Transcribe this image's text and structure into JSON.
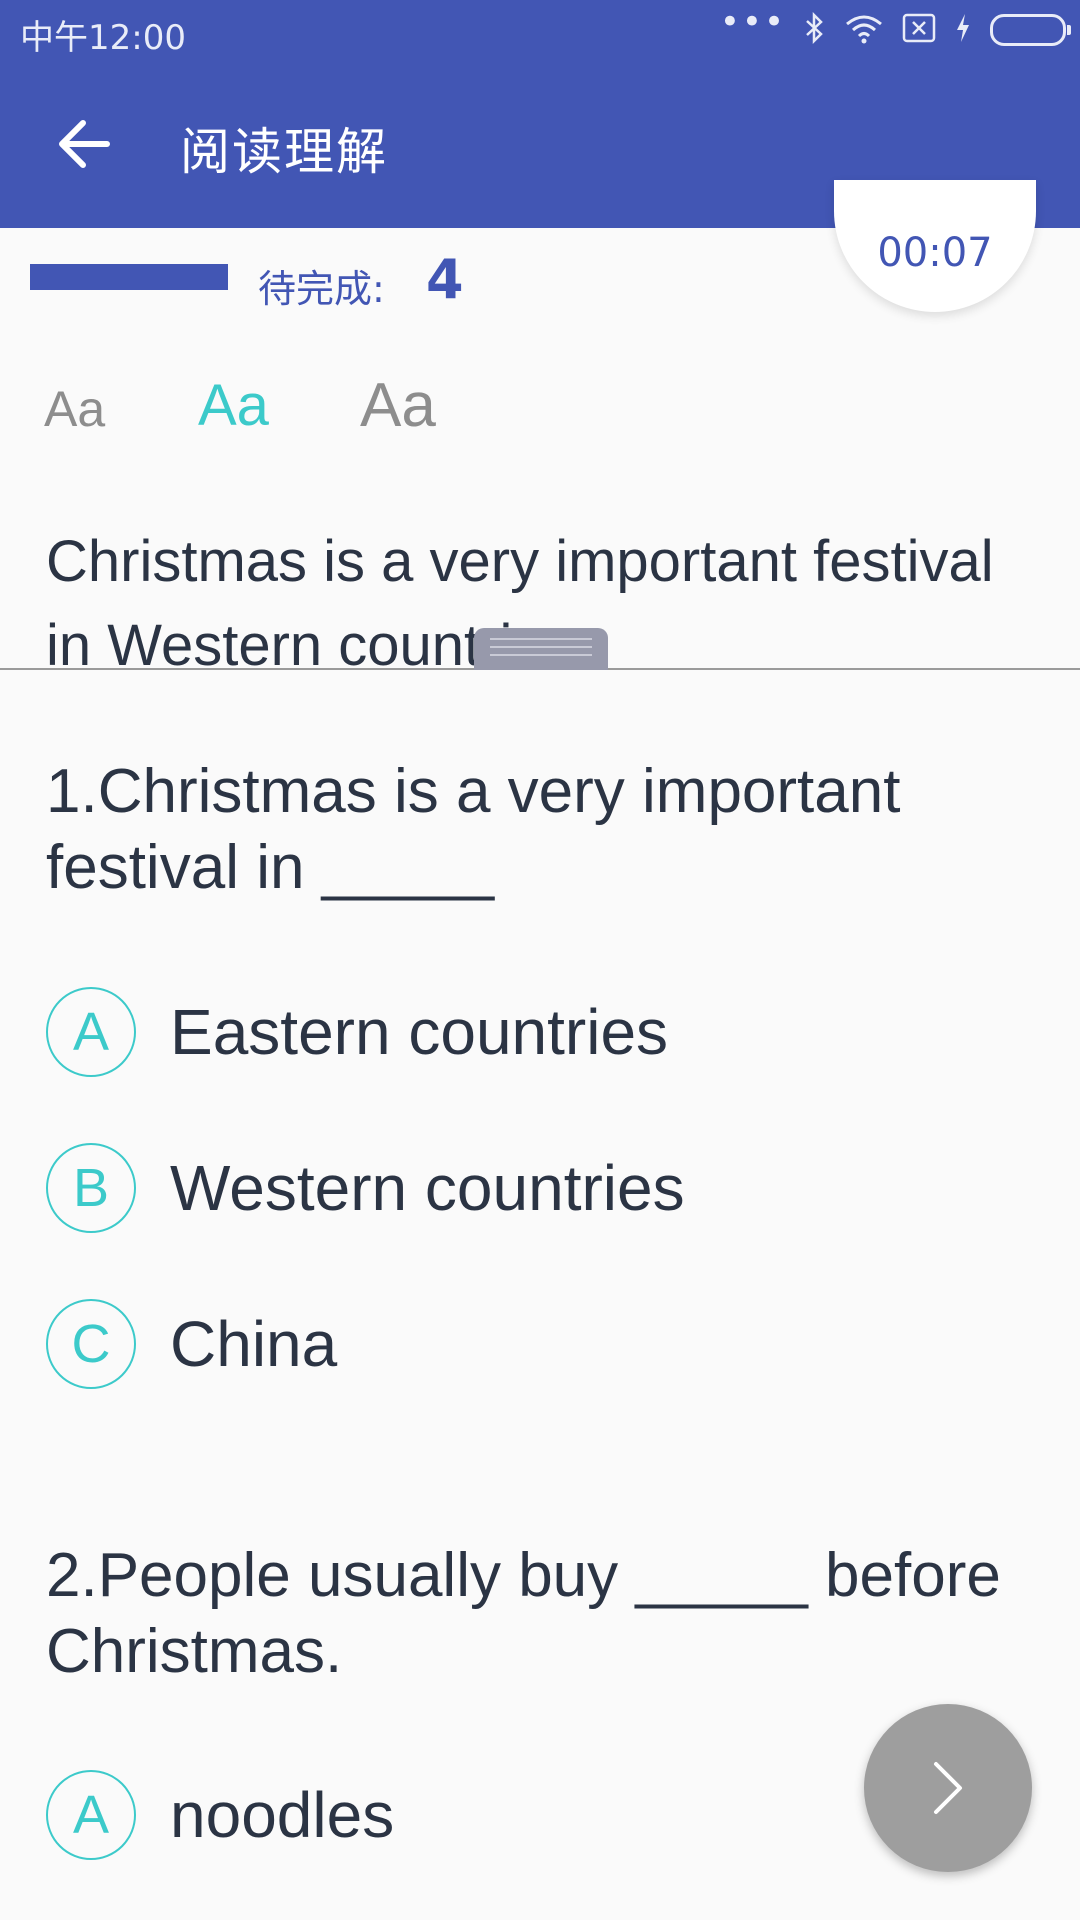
{
  "status_bar": {
    "time": "中午12:00",
    "dots": "•••"
  },
  "header": {
    "title": "阅读理解",
    "back_icon": "arrow-left-icon"
  },
  "progress": {
    "pending_label": "待完成:",
    "pending_count": "4",
    "timer": "00:07",
    "fill_fraction": 1.0
  },
  "font_sizes": {
    "small": "Aa",
    "medium": "Aa",
    "large": "Aa",
    "selected": "medium"
  },
  "passage": {
    "text": "Christmas is a very important festival in Western countries."
  },
  "questions": [
    {
      "text": "1.Christmas is a very important festival in _____",
      "options": [
        {
          "letter": "A",
          "text": "Eastern countries"
        },
        {
          "letter": "B",
          "text": "Western countries"
        },
        {
          "letter": "C",
          "text": "China"
        }
      ]
    },
    {
      "text": "2.People usually buy _____ before Christmas.",
      "options": [
        {
          "letter": "A",
          "text": "noodles"
        }
      ]
    }
  ],
  "colors": {
    "primary": "#4256b4",
    "accent": "#3ccaca",
    "fab": "#9e9e9e"
  },
  "fab": {
    "icon": "chevron-right-icon"
  }
}
